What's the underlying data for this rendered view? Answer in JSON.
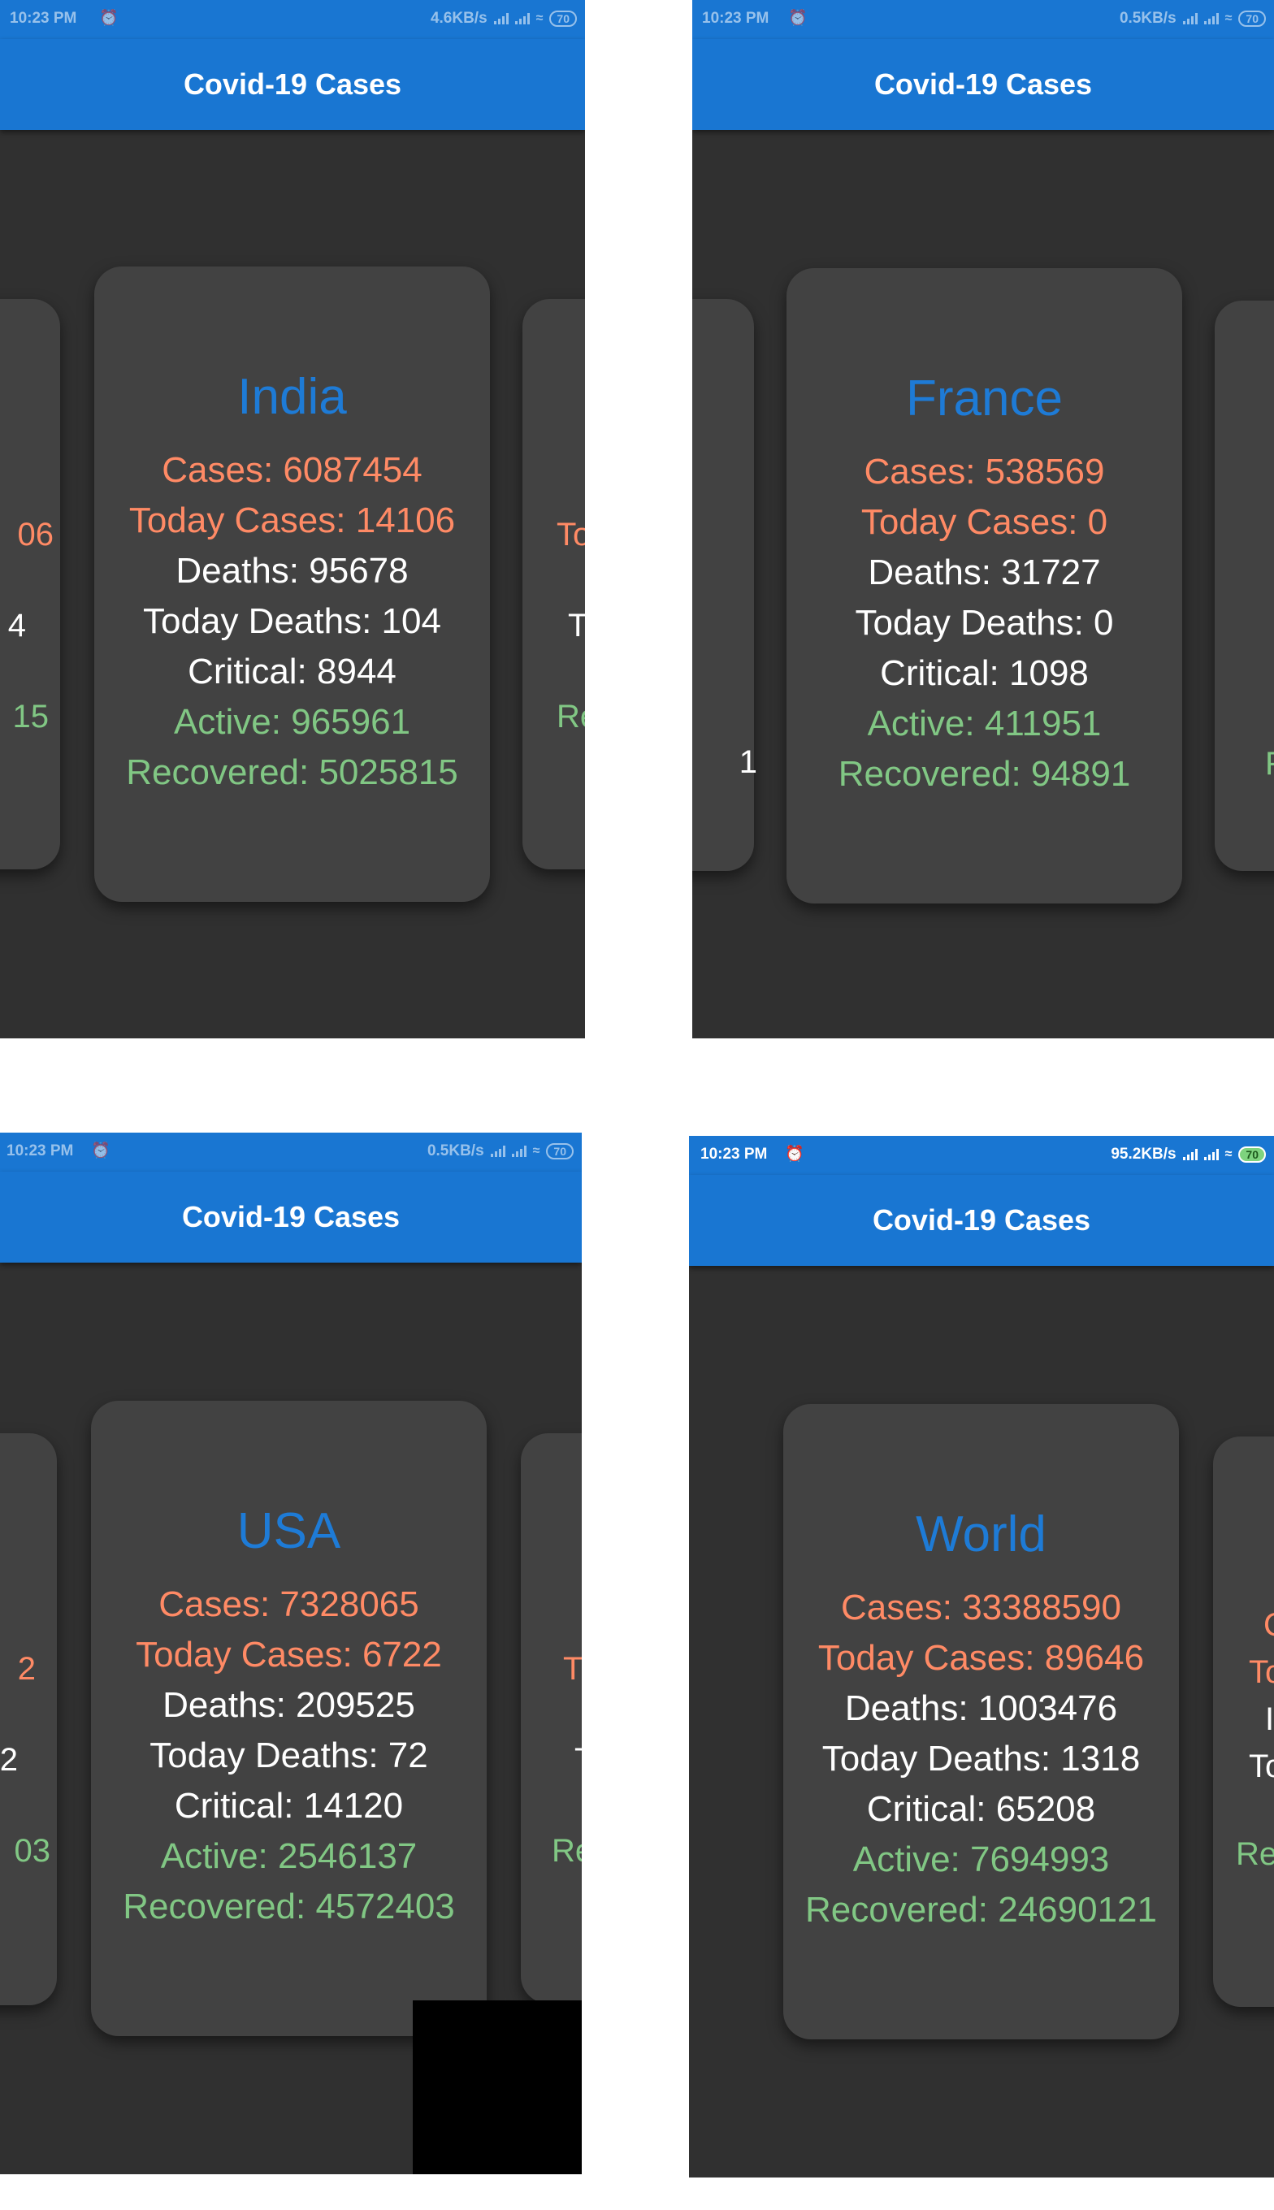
{
  "app": {
    "title": "Covid-19 Cases"
  },
  "colors": {
    "primary": "#1976d2",
    "background": "#303030",
    "card": "#424242",
    "country": "#1e7bd6",
    "cases": "#ff8a65",
    "deaths": "#ffffff",
    "recovered": "#81c784"
  },
  "icons": [
    "alarm-icon",
    "signal-icon",
    "wifi-icon",
    "battery-icon"
  ],
  "screens": [
    {
      "status": {
        "time": "10:23 PM",
        "speed": "4.6KB/s",
        "battery": "70"
      },
      "card": {
        "country": "India",
        "cases": "Cases: 6087454",
        "today_cases": "Today Cases: 14106",
        "deaths": "Deaths: 95678",
        "today_deaths": "Today Deaths: 104",
        "critical": "Critical: 8944",
        "active": "Active: 965961",
        "recovered": "Recovered: 5025815"
      },
      "left_peek": [
        "06",
        "4",
        "15"
      ],
      "right_peek": [
        "To",
        "T",
        "Re"
      ]
    },
    {
      "status": {
        "time": "10:23 PM",
        "speed": "0.5KB/s",
        "battery": "70"
      },
      "card": {
        "country": "France",
        "cases": "Cases: 538569",
        "today_cases": "Today Cases: 0",
        "deaths": "Deaths: 31727",
        "today_deaths": "Today Deaths: 0",
        "critical": "Critical: 1098",
        "active": "Active: 411951",
        "recovered": "Recovered: 94891"
      },
      "left_peek": [
        "1"
      ],
      "right_peek": [
        "F"
      ]
    },
    {
      "status": {
        "time": "10:23 PM",
        "speed": "0.5KB/s",
        "battery": "70"
      },
      "card": {
        "country": "USA",
        "cases": "Cases: 7328065",
        "today_cases": "Today Cases: 6722",
        "deaths": "Deaths: 209525",
        "today_deaths": "Today Deaths: 72",
        "critical": "Critical: 14120",
        "active": "Active: 2546137",
        "recovered": "Recovered: 4572403"
      },
      "left_peek": [
        "2",
        "2",
        "03"
      ],
      "right_peek": [
        "T",
        "T",
        "Re"
      ]
    },
    {
      "status": {
        "time": "10:23 PM",
        "speed": "95.2KB/s",
        "battery": "70"
      },
      "card": {
        "country": "World",
        "cases": "Cases: 33388590",
        "today_cases": "Today Cases: 89646",
        "deaths": "Deaths: 1003476",
        "today_deaths": "Today Deaths: 1318",
        "critical": "Critical: 65208",
        "active": "Active: 7694993",
        "recovered": "Recovered: 24690121"
      },
      "left_peek": [],
      "right_peek": [
        "C",
        "To",
        "I",
        "To",
        "Re"
      ]
    }
  ]
}
